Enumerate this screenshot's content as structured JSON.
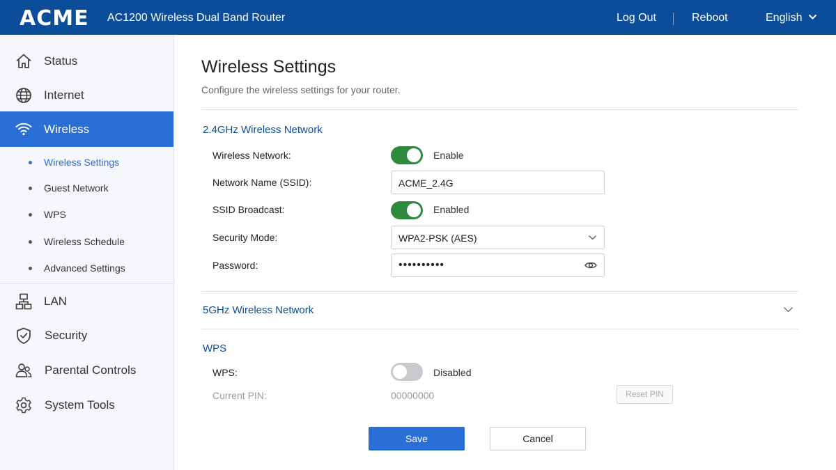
{
  "header": {
    "logo": "ACME",
    "model": "AC1200 Wireless Dual Band Router",
    "logout_label": "Log Out",
    "reboot_label": "Reboot",
    "language_label": "English",
    "bg_color": "#0b4d99"
  },
  "sidebar": {
    "items": [
      {
        "label": "Status",
        "icon": "home-icon"
      },
      {
        "label": "Internet",
        "icon": "globe-icon"
      },
      {
        "label": "Wireless",
        "icon": "wifi-icon",
        "active": true
      },
      {
        "label": "LAN",
        "icon": "network-icon"
      },
      {
        "label": "Security",
        "icon": "shield-icon"
      },
      {
        "label": "Parental Controls",
        "icon": "users-icon"
      },
      {
        "label": "System Tools",
        "icon": "gear-icon"
      }
    ],
    "subitems": [
      {
        "label": "Wireless Settings",
        "active": true
      },
      {
        "label": "Guest Network"
      },
      {
        "label": "WPS"
      },
      {
        "label": "Wireless Schedule"
      },
      {
        "label": "Advanced Settings"
      }
    ]
  },
  "page": {
    "title": "Wireless Settings",
    "subtitle": "Configure the wireless settings for your router."
  },
  "band24": {
    "title": "2.4GHz Wireless Network",
    "wireless_network_label": "Wireless Network:",
    "wireless_network_state": "Enable",
    "ssid_label": "Network Name (SSID):",
    "ssid_value": "ACME_2.4G",
    "broadcast_label": "SSID Broadcast:",
    "broadcast_state": "Enabled",
    "security_label": "Security Mode:",
    "security_value": "WPA2-PSK (AES)",
    "password_label": "Password:",
    "password_value": "••••••••••"
  },
  "band5": {
    "title": "5GHz Wireless Network"
  },
  "wps": {
    "title": "WPS",
    "wps_label": "WPS:",
    "wps_state": "Disabled",
    "pin_label": "Current PIN:",
    "pin_value": "00000000",
    "reset_label": "Reset PIN"
  },
  "actions": {
    "save_label": "Save",
    "cancel_label": "Cancel"
  },
  "colors": {
    "accent": "#2a6fd6",
    "toggle_on": "#2e8b3e",
    "section_title": "#0b4d99"
  }
}
